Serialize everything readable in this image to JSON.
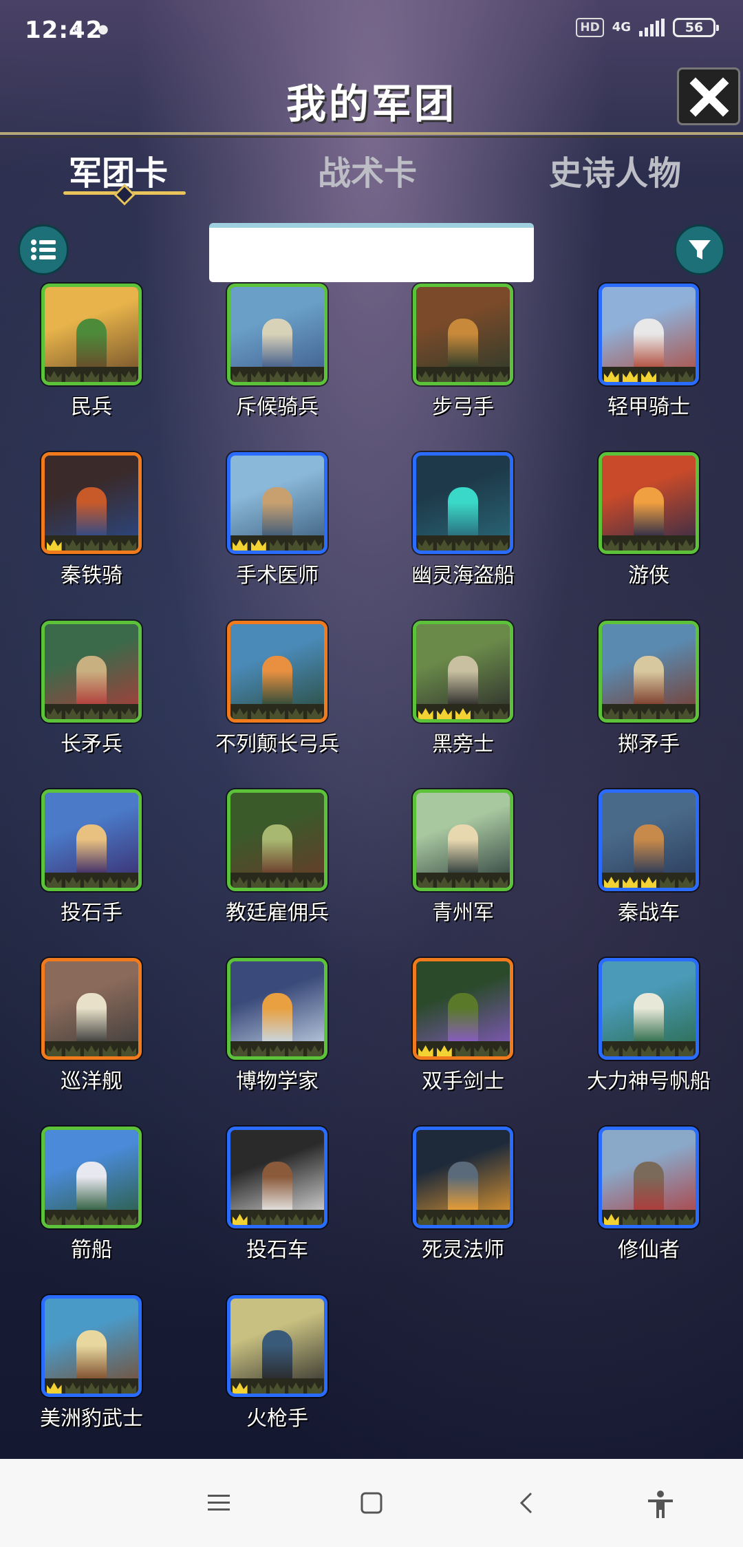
{
  "status": {
    "time": "12:42",
    "hd": "HD",
    "network": "4G",
    "battery": "56"
  },
  "header": {
    "title": "我的军团"
  },
  "tabs": [
    {
      "label": "军团卡"
    },
    {
      "label": "战术卡"
    },
    {
      "label": "史诗人物"
    }
  ],
  "search": {
    "value": "",
    "placeholder": ""
  },
  "colors": {
    "green": "#5cc23a",
    "blue": "#2a6cff",
    "orange": "#f07a1c",
    "gold": "#f3d233"
  },
  "cards": [
    {
      "name": "民兵",
      "rarity": "green",
      "stars": 0
    },
    {
      "name": "斥候骑兵",
      "rarity": "green",
      "stars": 0
    },
    {
      "name": "步弓手",
      "rarity": "green",
      "stars": 0
    },
    {
      "name": "轻甲骑士",
      "rarity": "blue",
      "stars": 3
    },
    {
      "name": "秦铁骑",
      "rarity": "orange",
      "stars": 1
    },
    {
      "name": "手术医师",
      "rarity": "blue",
      "stars": 2
    },
    {
      "name": "幽灵海盗船",
      "rarity": "blue",
      "stars": 0
    },
    {
      "name": "游侠",
      "rarity": "green",
      "stars": 0
    },
    {
      "name": "长矛兵",
      "rarity": "green",
      "stars": 0
    },
    {
      "name": "不列颠长弓兵",
      "rarity": "orange",
      "stars": 0
    },
    {
      "name": "黑旁士",
      "rarity": "green",
      "stars": 3
    },
    {
      "name": "掷矛手",
      "rarity": "green",
      "stars": 0
    },
    {
      "name": "投石手",
      "rarity": "green",
      "stars": 0
    },
    {
      "name": "教廷雇佣兵",
      "rarity": "green",
      "stars": 0
    },
    {
      "name": "青州军",
      "rarity": "green",
      "stars": 0
    },
    {
      "name": "秦战车",
      "rarity": "blue",
      "stars": 3
    },
    {
      "name": "巡洋舰",
      "rarity": "orange",
      "stars": 0
    },
    {
      "name": "博物学家",
      "rarity": "green",
      "stars": 0
    },
    {
      "name": "双手剑士",
      "rarity": "orange",
      "stars": 2
    },
    {
      "name": "大力神号帆船",
      "rarity": "blue",
      "stars": 0
    },
    {
      "name": "箭船",
      "rarity": "green",
      "stars": 0
    },
    {
      "name": "投石车",
      "rarity": "blue",
      "stars": 1
    },
    {
      "name": "死灵法师",
      "rarity": "blue",
      "stars": 0
    },
    {
      "name": "修仙者",
      "rarity": "blue",
      "stars": 1
    },
    {
      "name": "美洲豹武士",
      "rarity": "blue",
      "stars": 1
    },
    {
      "name": "火枪手",
      "rarity": "blue",
      "stars": 1
    }
  ]
}
